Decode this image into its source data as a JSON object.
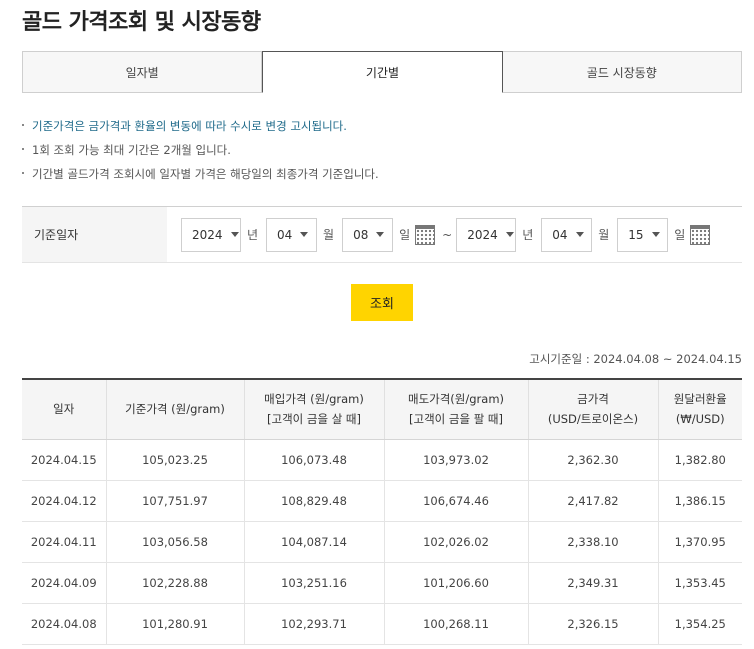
{
  "page": {
    "title": "골드 가격조회 및 시장동향"
  },
  "tabs": [
    {
      "label": "일자별",
      "active": false
    },
    {
      "label": "기간별",
      "active": true
    },
    {
      "label": "골드 시장동향",
      "active": false
    }
  ],
  "notes": [
    "기준가격은 금가격과 환율의 변동에 따라 수시로 변경 고시됩니다.",
    "1회 조회 가능 최대 기간은 2개월 입니다.",
    "기간별 골드가격 조회시에 일자별 가격은 해당일의 최종가격 기준입니다."
  ],
  "date_filter": {
    "label": "기준일자",
    "start": {
      "year": "2024",
      "month": "04",
      "day": "08"
    },
    "end": {
      "year": "2024",
      "month": "04",
      "day": "15"
    },
    "unit_year": "년",
    "unit_month": "월",
    "unit_day": "일",
    "separator": "~"
  },
  "search_button": "조회",
  "basis_text": "고시기준일 : 2024.04.08 ~ 2024.04.15",
  "table": {
    "headers": [
      [
        "일자",
        ""
      ],
      [
        "기준가격 (원/gram)",
        ""
      ],
      [
        "매입가격 (원/gram)",
        "[고객이 금을 살 때]"
      ],
      [
        "매도가격(원/gram)",
        "[고객이 금을 팔 때]"
      ],
      [
        "금가격",
        "(USD/트로이온스)"
      ],
      [
        "원달러환율",
        "(₩/USD)"
      ]
    ],
    "rows": [
      [
        "2024.04.15",
        "105,023.25",
        "106,073.48",
        "103,973.02",
        "2,362.30",
        "1,382.80"
      ],
      [
        "2024.04.12",
        "107,751.97",
        "108,829.48",
        "106,674.46",
        "2,417.82",
        "1,386.15"
      ],
      [
        "2024.04.11",
        "103,056.58",
        "104,087.14",
        "102,026.02",
        "2,338.10",
        "1,370.95"
      ],
      [
        "2024.04.09",
        "102,228.88",
        "103,251.16",
        "101,206.60",
        "2,349.31",
        "1,353.45"
      ],
      [
        "2024.04.08",
        "101,280.91",
        "102,293.71",
        "100,268.11",
        "2,326.15",
        "1,354.25"
      ]
    ]
  },
  "colors": {
    "accent": "#ffd400",
    "note_highlight": "#1f6a8a"
  }
}
